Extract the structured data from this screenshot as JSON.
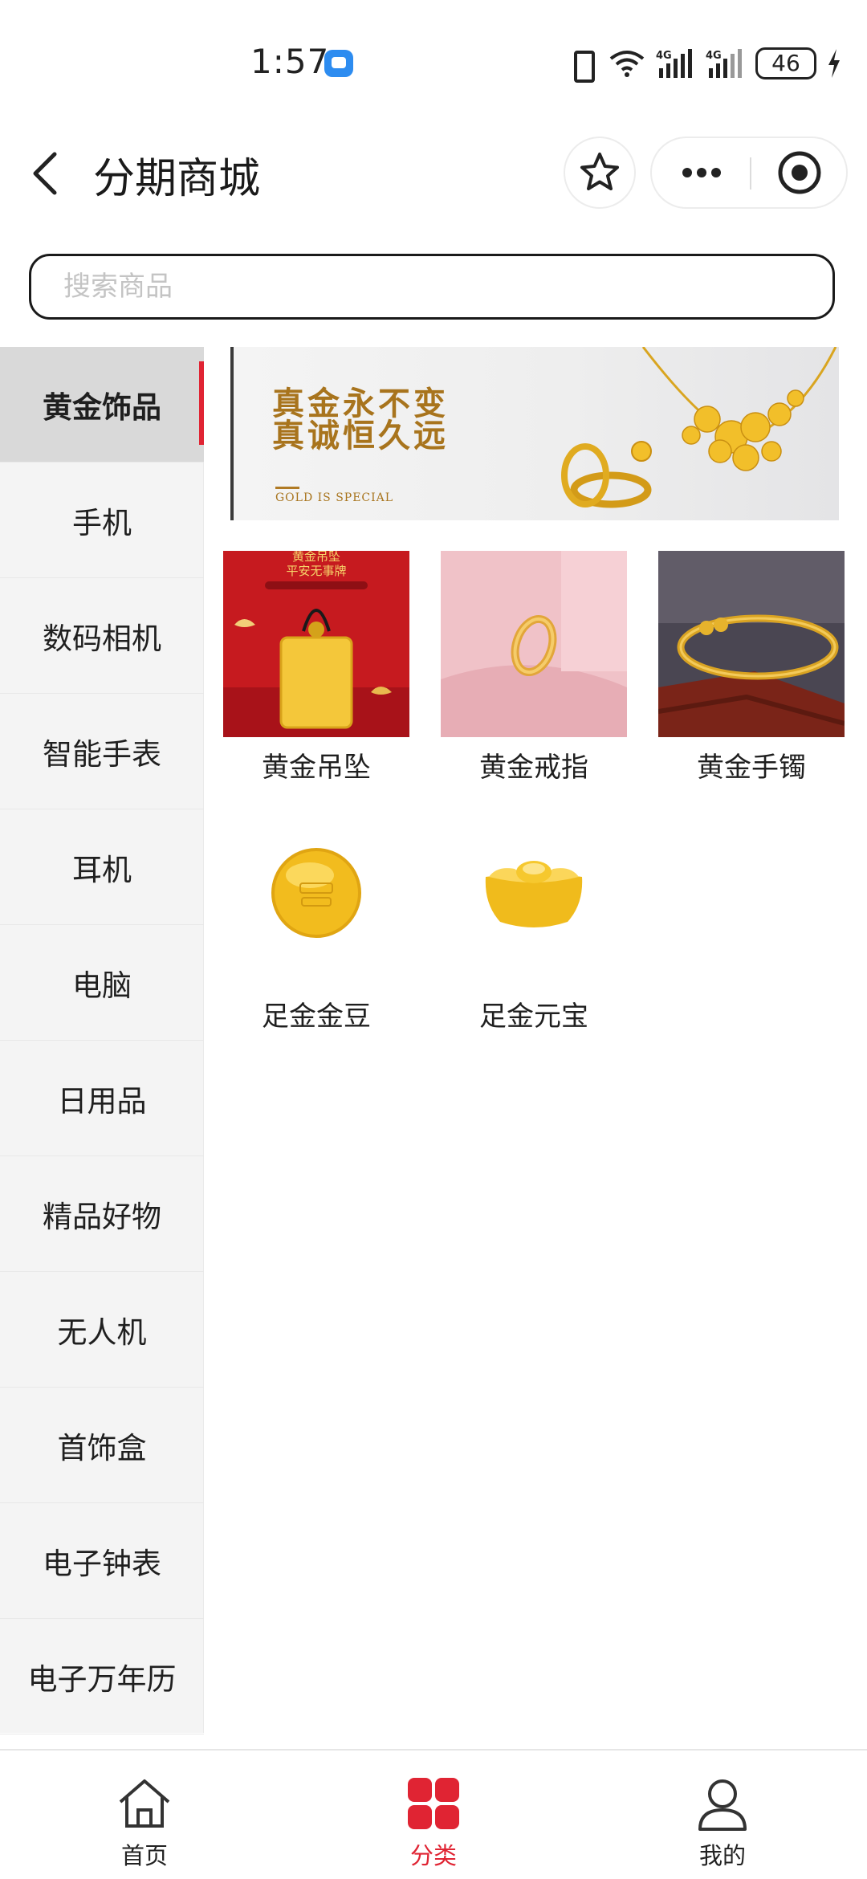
{
  "status_bar": {
    "time": "1:57",
    "battery": "46"
  },
  "header": {
    "title": "分期商城"
  },
  "search": {
    "placeholder": "搜索商品"
  },
  "sidebar": {
    "items": [
      {
        "label": "黄金饰品",
        "active": true
      },
      {
        "label": "手机"
      },
      {
        "label": "数码相机"
      },
      {
        "label": "智能手表"
      },
      {
        "label": "耳机"
      },
      {
        "label": "电脑"
      },
      {
        "label": "日用品"
      },
      {
        "label": "精品好物"
      },
      {
        "label": "无人机"
      },
      {
        "label": "首饰盒"
      },
      {
        "label": "电子钟表"
      },
      {
        "label": "电子万年历"
      }
    ]
  },
  "banner": {
    "line1": "真金永不变",
    "line2": "真诚恒久远",
    "subtitle": "GOLD IS SPECIAL"
  },
  "products": [
    {
      "name": "黄金吊坠",
      "image_text_1": "黄金吊坠",
      "image_text_2": "平安无事牌"
    },
    {
      "name": "黄金戒指"
    },
    {
      "name": "黄金手镯"
    },
    {
      "name": "足金金豆"
    },
    {
      "name": "足金元宝"
    }
  ],
  "tabbar": {
    "items": [
      {
        "label": "首页",
        "icon": "home-icon"
      },
      {
        "label": "分类",
        "icon": "category-icon",
        "active": true
      },
      {
        "label": "我的",
        "icon": "user-icon"
      }
    ]
  },
  "colors": {
    "accent": "#e02433",
    "gold": "#f0b81e"
  }
}
